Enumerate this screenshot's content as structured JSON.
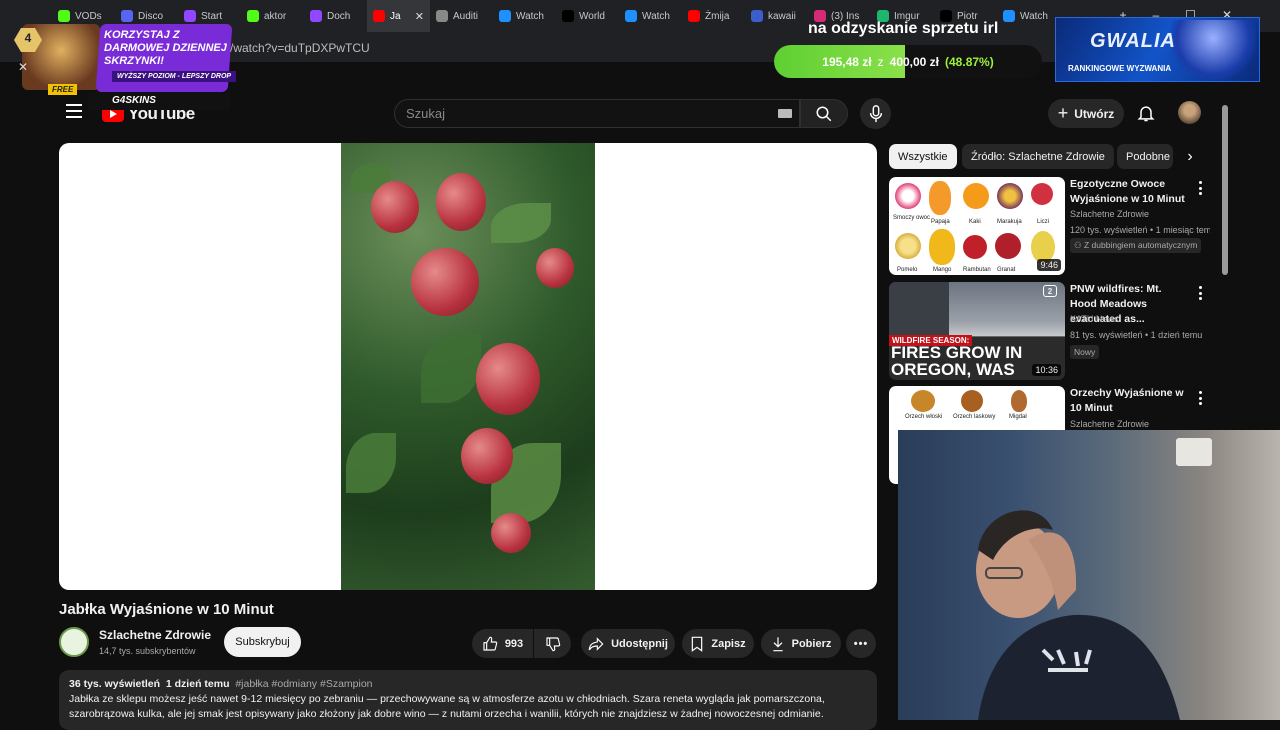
{
  "browser": {
    "tabs": [
      {
        "label": "VODs",
        "icon": "kick-icon",
        "color": "#53fc18"
      },
      {
        "label": "Disco",
        "icon": "discord-icon",
        "color": "#5865f2"
      },
      {
        "label": "Start",
        "icon": "twitch-icon",
        "color": "#9146ff"
      },
      {
        "label": "aktor",
        "icon": "kick-icon",
        "color": "#53fc18"
      },
      {
        "label": "Doch",
        "icon": "twitch-icon",
        "color": "#9146ff"
      },
      {
        "label": "Ja",
        "icon": "youtube-icon",
        "color": "#ff0000",
        "active": true
      },
      {
        "label": "Auditi",
        "icon": "globe-icon",
        "color": "#888888"
      },
      {
        "label": "Watch",
        "icon": "streamelements-icon",
        "color": "#1e90ff"
      },
      {
        "label": "World",
        "icon": "tiktok-icon",
        "color": "#000000"
      },
      {
        "label": "Watch",
        "icon": "streamelements-icon",
        "color": "#1e90ff"
      },
      {
        "label": "Żmija",
        "icon": "youtube-icon",
        "color": "#ff0000"
      },
      {
        "label": "kawaii",
        "icon": "site-icon",
        "color": "#3a5fcd"
      },
      {
        "label": "(3) Ins",
        "icon": "instagram-icon",
        "color": "#d62976"
      },
      {
        "label": "Imgur",
        "icon": "imgur-icon",
        "color": "#1bb76e"
      },
      {
        "label": "Piotr",
        "icon": "x-icon",
        "color": "#000000"
      },
      {
        "label": "Watch",
        "icon": "streamelements-icon",
        "color": "#1e90ff"
      }
    ],
    "new_tab": "+",
    "url": "/watch?v=duTpDXPwTCU"
  },
  "youtube": {
    "logo_text": "YouTube",
    "search_placeholder": "Szukaj",
    "create_label": "Utwórz"
  },
  "video": {
    "title": "Jabłka Wyjaśnione w 10 Minut",
    "channel": "Szlachetne Zdrowie",
    "subscribers": "14,7 tys. subskrybentów",
    "subscribe_label": "Subskrybuj",
    "likes": "993",
    "share_label": "Udostępnij",
    "save_label": "Zapisz",
    "download_label": "Pobierz",
    "views": "36 tys. wyświetleń",
    "age": "1 dzień temu",
    "tags": "#jabłka #odmiany #Szampion",
    "description": "Jabłka ze sklepu możesz jeść nawet 9-12 miesięcy po zebraniu — przechowywane są w atmosferze azotu w chłodniach. Szara reneta wygląda jak pomarszczona, szarobrązowa kulka, ale jej smak jest opisywany jako złożony jak dobre wino — z nutami orzecha i wanilii, których nie znajdziesz w żadnej nowoczesnej odmianie."
  },
  "chips": [
    "Wszystkie",
    "Źródło: Szlachetne Zdrowie",
    "Podobne"
  ],
  "recommendations": [
    {
      "title": "Egzotyczne Owoce Wyjaśnione w 10 Minut",
      "channel": "Szlachetne Zdrowie",
      "meta": "120 tys. wyświetleń • 1 miesiąc temu",
      "badge": "Z dubbingiem automatycznym",
      "duration": "9:46",
      "fruits": [
        "Smoczy owoc",
        "Papaja",
        "Kaki",
        "Marakuja",
        "Liczi",
        "Pomelo",
        "Mango",
        "Rambutan",
        "Granat",
        ""
      ]
    },
    {
      "title": "PNW wildfires: Mt. Hood Meadows evacuated as...",
      "channel": "KATU News",
      "meta": "81 tys. wyświetleń • 1 dzień temu",
      "badge": "Nowy",
      "duration": "10:36",
      "thumb_kicker": "WILDFIRE SEASON:",
      "thumb_headline": "FIRES GROW IN OREGON, WAS",
      "thumb_logo": "2"
    },
    {
      "title": "Orzechy Wyjaśnione w 10 Minut",
      "channel": "Szlachetne Zdrowie",
      "fruits": [
        "Orzech włoski",
        "Orzech laskowy",
        "Migdał"
      ]
    }
  ],
  "overlay": {
    "promo_level": "4",
    "promo_headline": "KORZYSTAJ Z DARMOWEJ DZIENNEJ SKRZYNKI!",
    "promo_tagline": "WYŻSZY POZIOM - LEPSZY DROP",
    "promo_free": "FREE",
    "promo_brand": "G4SKINS",
    "goal_title": "na odzyskanie sprzetu irl",
    "goal_current": "195,48 zł",
    "goal_sep": "z",
    "goal_target": "400,00 zł",
    "goal_percent": "(48.87%)",
    "goal_fraction": 0.4887,
    "sponsor_title": "GWALIA",
    "sponsor_sub": "RANKINGOWE WYZWANIA"
  }
}
